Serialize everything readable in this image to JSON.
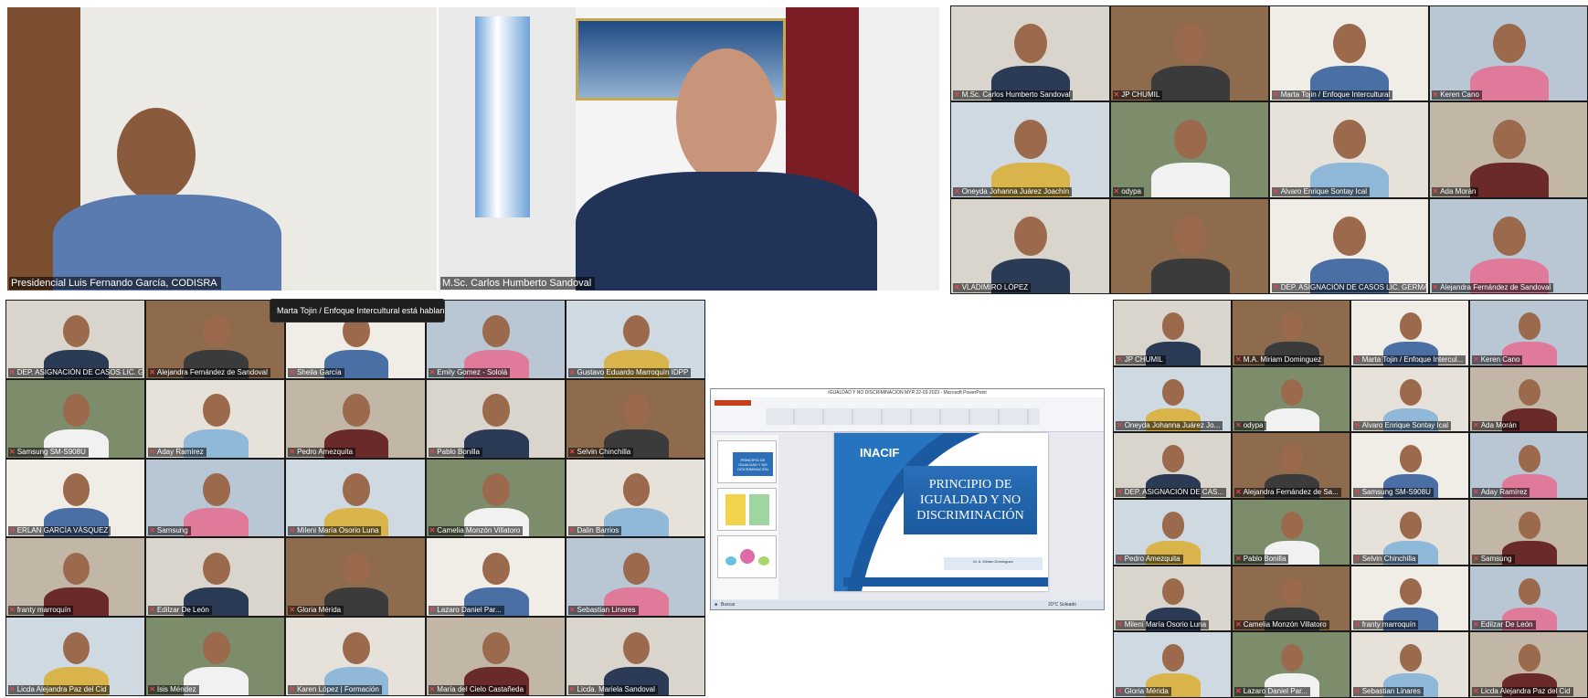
{
  "main_speakers": {
    "left": "Presidencial Luis Fernando García, CODISRA",
    "right": "M.Sc. Carlos Humberto Sandoval"
  },
  "toast": "Marta Tojin / Enfoque Intercultural está hablando...",
  "top_right_grid": [
    "M.Sc. Carlos Humberto Sandoval",
    "JP CHUMIL",
    "Marta Tojin / Enfoque Intercultural",
    "Keren Cano",
    "Oneyda Johanna Juárez Joachín",
    "odypa",
    "Alvaro Enrique Sontay Ical",
    "Ada Morán",
    "VLADIMIRO LÓPEZ",
    "",
    "DEP. ASIGNACIÓN DE CASOS LIC. GERMAN POP",
    "Alejandra Fernández de Sandoval"
  ],
  "left_grid": [
    "DEP. ASIGNACIÓN DE CASOS LIC. GER...",
    "Alejandra Fernández de Sandoval",
    "Sheila García",
    "Emily Gomez - Sololá",
    "Gustavo Eduardo Marroquín IDPP",
    "Samsung SM-S908U",
    "Aday Ramírez",
    "Pedro Amezquita",
    "Pablo Bonilla",
    "Selvin Chinchilla",
    "ERLAN GARCÍA VÁSQUEZ",
    "Samsung",
    "Mileni María Osorio Luna",
    "Camelia Monzón Villatoro",
    "Dalin Barrios",
    "franty marroquín",
    "Edilzar De León",
    "Gloria Mérida",
    "Lazaro Daniel Par...",
    "Sebastian Linares",
    "Licda Alejandra Paz del Cid",
    "Isis Méndez",
    "Karen López | Formación",
    "María del Cielo Castañeda",
    "Licda. Mariela Sandoval"
  ],
  "bottom_right_grid": [
    "JP CHUMIL",
    "M.A. Miriam Dominguez",
    "Marta Tojin / Enfoque Intercul...",
    "Keren Cano",
    "Oneyda Johanna Juárez Jo...",
    "odypa",
    "Alvaro Enrique Sontay Ical",
    "Ada Morán",
    "DEP. ASIGNACIÓN DE CAS...",
    "Alejandra Fernández de Sa...",
    "Samsung SM-S908U",
    "Aday Ramírez",
    "Pedro Amezquita",
    "Pablo Bonilla",
    "Selvin Chinchilla",
    "Samsung",
    "Mileni María Osorio Luna",
    "Camelia Monzón Villatoro",
    "franty marroquín",
    "Edilzar De León",
    "Gloria Mérida",
    "Lazaro Daniel Par...",
    "Sebastian Linares",
    "Licda Alejandra Paz del Cid"
  ],
  "shared_screen": {
    "window_title": "IGUALDAD Y NO DISCRIMINACION MYR 22-03-2023 - Microsoft PowerPoint",
    "slide_logo": "INACIF",
    "slide_title": "PRINCIPIO DE IGUALDAD Y NO DISCRIMINACIÓN",
    "slide_subtitle": "M. A. Miriam Dominguez",
    "thumb_title": "PRINCIPIO DE IGUALDAD Y NO DISCRIMINACIÓN",
    "taskbar_search": "Buscar",
    "taskbar_weather": "20°C Soleado"
  },
  "colors": {
    "active_speaker": "#2fbf71",
    "muted_mic": "#e5484d"
  }
}
